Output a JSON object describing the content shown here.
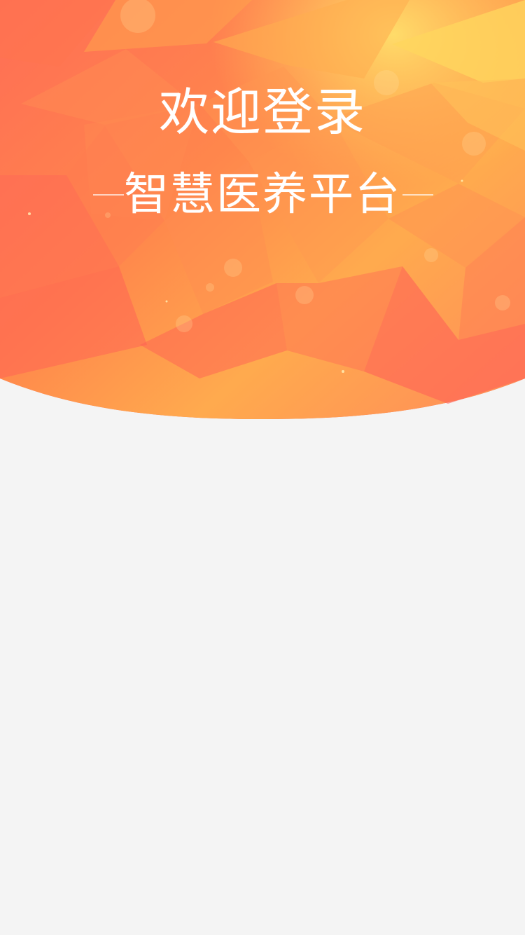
{
  "hero": {
    "title": "欢迎登录",
    "subtitle": "智慧医养平台"
  },
  "colors": {
    "background": "#f4f4f4",
    "hero_red": "#ff5a57",
    "hero_orange": "#ff8c4d",
    "hero_yellow": "#ffcf5a",
    "text": "#ffffff"
  }
}
